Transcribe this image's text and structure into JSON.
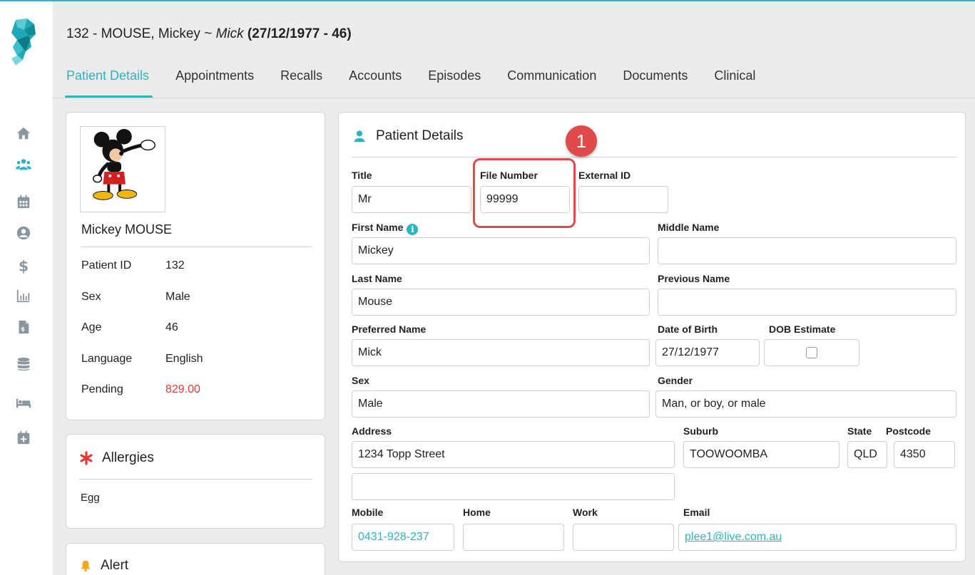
{
  "header": {
    "id_name": "132 - MOUSE, Mickey ~ ",
    "nickname": "Mick",
    "dob_age": " (27/12/1977 - 46)"
  },
  "tabs": [
    {
      "label": "Patient Details",
      "active": true
    },
    {
      "label": "Appointments"
    },
    {
      "label": "Recalls"
    },
    {
      "label": "Accounts"
    },
    {
      "label": "Episodes"
    },
    {
      "label": "Communication"
    },
    {
      "label": "Documents"
    },
    {
      "label": "Clinical"
    }
  ],
  "sidebar_icons": [
    "home-icon",
    "patients-icon",
    "calendar-icon",
    "user-circle-icon",
    "dollar-icon",
    "chart-icon",
    "invoice-icon",
    "database-icon",
    "bed-icon",
    "calendar-plus-icon"
  ],
  "summary": {
    "name": "Mickey MOUSE",
    "rows": [
      {
        "label": "Patient ID",
        "value": "132"
      },
      {
        "label": "Sex",
        "value": "Male"
      },
      {
        "label": "Age",
        "value": "46"
      },
      {
        "label": "Language",
        "value": "English"
      },
      {
        "label": "Pending",
        "value": "829.00"
      }
    ]
  },
  "allergies": {
    "title": "Allergies",
    "items": [
      "Egg"
    ]
  },
  "alert": {
    "title": "Alert"
  },
  "details": {
    "title": "Patient Details",
    "labels": {
      "title": "Title",
      "file_number": "File Number",
      "external_id": "External ID",
      "first_name": "First Name",
      "middle_name": "Middle Name",
      "last_name": "Last Name",
      "previous_name": "Previous Name",
      "preferred_name": "Preferred Name",
      "dob": "Date of Birth",
      "dob_estimate": "DOB Estimate",
      "sex": "Sex",
      "gender": "Gender",
      "address": "Address",
      "suburb": "Suburb",
      "state": "State",
      "postcode": "Postcode",
      "mobile": "Mobile",
      "home": "Home",
      "work": "Work",
      "email": "Email"
    },
    "values": {
      "title": "Mr",
      "file_number": "99999",
      "external_id": "",
      "first_name": "Mickey",
      "middle_name": "",
      "last_name": "Mouse",
      "previous_name": "",
      "preferred_name": "Mick",
      "dob": "27/12/1977",
      "sex": "Male",
      "gender": "Man, or boy, or male",
      "address_line1": "1234 Topp Street",
      "address_line2": "",
      "suburb": "TOOWOOMBA",
      "state": "QLD",
      "postcode": "4350",
      "mobile": "0431-928-237",
      "home": "",
      "work": "",
      "email": "plee1@live.com.au"
    },
    "dob_estimate_checked": false
  },
  "annotation": {
    "step": "1"
  },
  "colors": {
    "accent": "#2bb5c4",
    "pending": "#e53935",
    "annotation": "#e04a4a",
    "alert": "#f5a623"
  }
}
